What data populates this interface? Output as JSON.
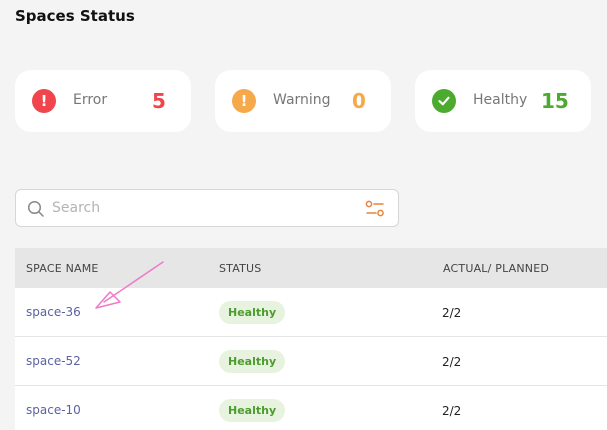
{
  "page": {
    "title": "Spaces Status"
  },
  "summary": {
    "error": {
      "label": "Error",
      "count": "5",
      "color": "#f0454d",
      "icon": "error-icon"
    },
    "warning": {
      "label": "Warning",
      "count": "0",
      "color": "#f5a94a",
      "icon": "warning-icon"
    },
    "healthy": {
      "label": "Healthy",
      "count": "15",
      "color": "#4caa2e",
      "icon": "check-icon"
    }
  },
  "search": {
    "placeholder": "Search",
    "value": ""
  },
  "table": {
    "columns": [
      "SPACE NAME",
      "STATUS",
      "ACTUAL/ PLANNED"
    ],
    "rows": [
      {
        "name": "space-36",
        "status": "Healthy",
        "ratio": "2/2"
      },
      {
        "name": "space-52",
        "status": "Healthy",
        "ratio": "2/2"
      },
      {
        "name": "space-10",
        "status": "Healthy",
        "ratio": "2/2"
      }
    ]
  },
  "colors": {
    "link": "#5b62a0",
    "accent": "#e9833a",
    "annotation": "#f07ac8"
  }
}
